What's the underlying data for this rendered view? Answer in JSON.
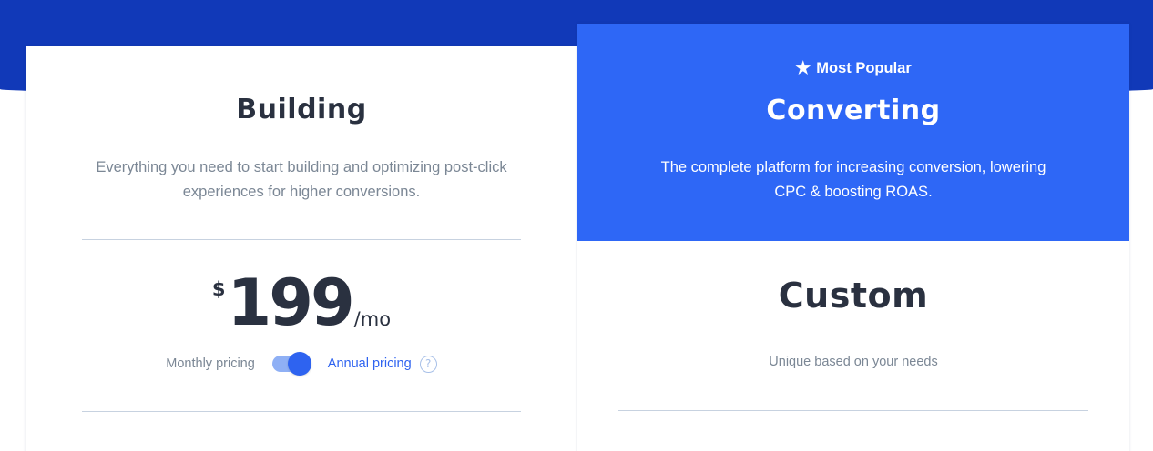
{
  "colors": {
    "hero_band": "#1139b8",
    "accent": "#2e67f6",
    "heading_text": "#2a3140",
    "muted_text": "#7b8795"
  },
  "building": {
    "title": "Building",
    "description": "Everything you need to start building and optimizing post-click experiences for higher conversions.",
    "price": {
      "currency": "$",
      "amount": "199",
      "period": "/mo"
    },
    "billing_toggle": {
      "left_label": "Monthly pricing",
      "right_label": "Annual pricing",
      "state": "annual",
      "help_icon": "question-circle-icon",
      "help_glyph": "?"
    }
  },
  "converting": {
    "badge": {
      "icon": "star-icon",
      "glyph": "★",
      "label": "Most Popular"
    },
    "title": "Converting",
    "description": "The complete platform for increasing conversion, lowering CPC & boosting ROAS.",
    "price_label": "Custom",
    "price_note": "Unique based on your needs"
  }
}
